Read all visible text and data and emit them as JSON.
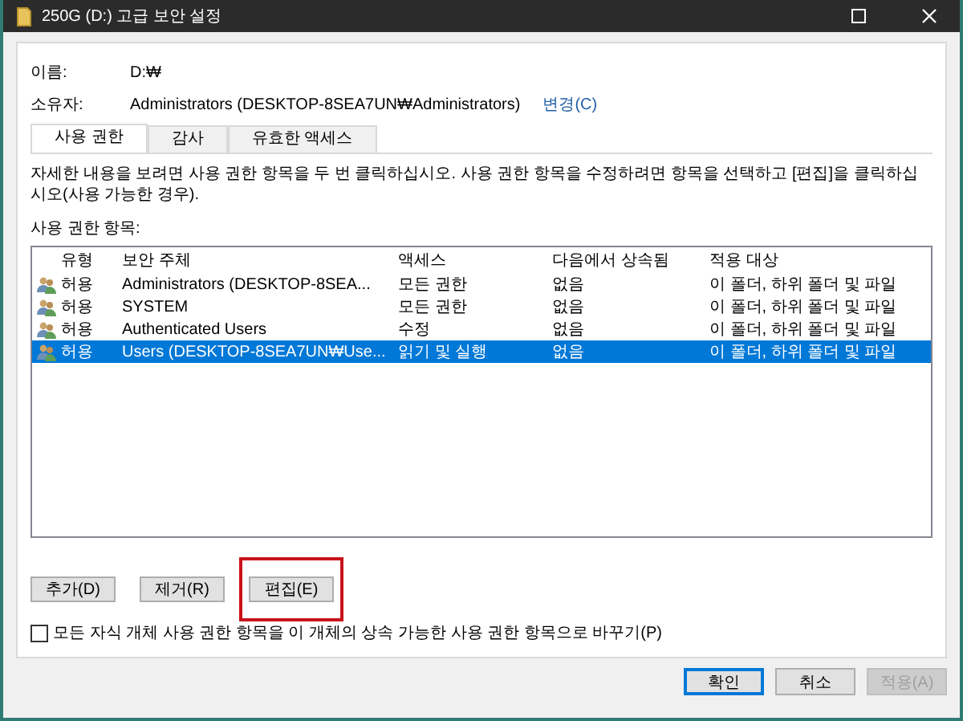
{
  "window": {
    "title": "250G (D:) 고급 보안 설정"
  },
  "fields": [
    {
      "label": "이름:",
      "value": "D:₩"
    },
    {
      "label": "소유자:",
      "value": "Administrators (DESKTOP-8SEA7UN₩Administrators)",
      "link": "변경(C)"
    }
  ],
  "tabs": [
    {
      "label": "사용 권한",
      "selected": true
    },
    {
      "label": "감사",
      "selected": false
    },
    {
      "label": "유효한 액세스",
      "selected": false
    }
  ],
  "instructions": "자세한 내용을 보려면 사용 권한 항목을 두 번 클릭하십시오. 사용 권한 항목을 수정하려면 항목을 선택하고 [편집]을 클릭하십시오(사용 가능한 경우).",
  "list_label": "사용 권한 항목:",
  "table": {
    "columns": [
      "유형",
      "보안 주체",
      "액세스",
      "다음에서 상속됨",
      "적용 대상"
    ],
    "rows": [
      {
        "cells": [
          "허용",
          "Administrators (DESKTOP-8SEA...",
          "모든 권한",
          "없음",
          "이 폴더, 하위 폴더 및 파일"
        ],
        "selected": false
      },
      {
        "cells": [
          "허용",
          "SYSTEM",
          "모든 권한",
          "없음",
          "이 폴더, 하위 폴더 및 파일"
        ],
        "selected": false
      },
      {
        "cells": [
          "허용",
          "Authenticated Users",
          "수정",
          "없음",
          "이 폴더, 하위 폴더 및 파일"
        ],
        "selected": false
      },
      {
        "cells": [
          "허용",
          "Users (DESKTOP-8SEA7UN₩Use...",
          "읽기 및 실행",
          "없음",
          "이 폴더, 하위 폴더 및 파일"
        ],
        "selected": true
      }
    ]
  },
  "list_buttons": [
    {
      "label": "추가(D)",
      "highlighted": false
    },
    {
      "label": "제거(R)",
      "highlighted": false
    },
    {
      "label": "편집(E)",
      "highlighted": true
    }
  ],
  "replace_option": {
    "label": "모든 자식 개체 사용 권한 항목을 이 개체의 상속 가능한 사용 권한 항목으로 바꾸기(P)",
    "checked": false
  },
  "dialog_buttons": [
    {
      "label": "확인",
      "default": true,
      "disabled": false
    },
    {
      "label": "취소",
      "default": false,
      "disabled": false
    },
    {
      "label": "적용(A)",
      "default": false,
      "disabled": true
    }
  ]
}
